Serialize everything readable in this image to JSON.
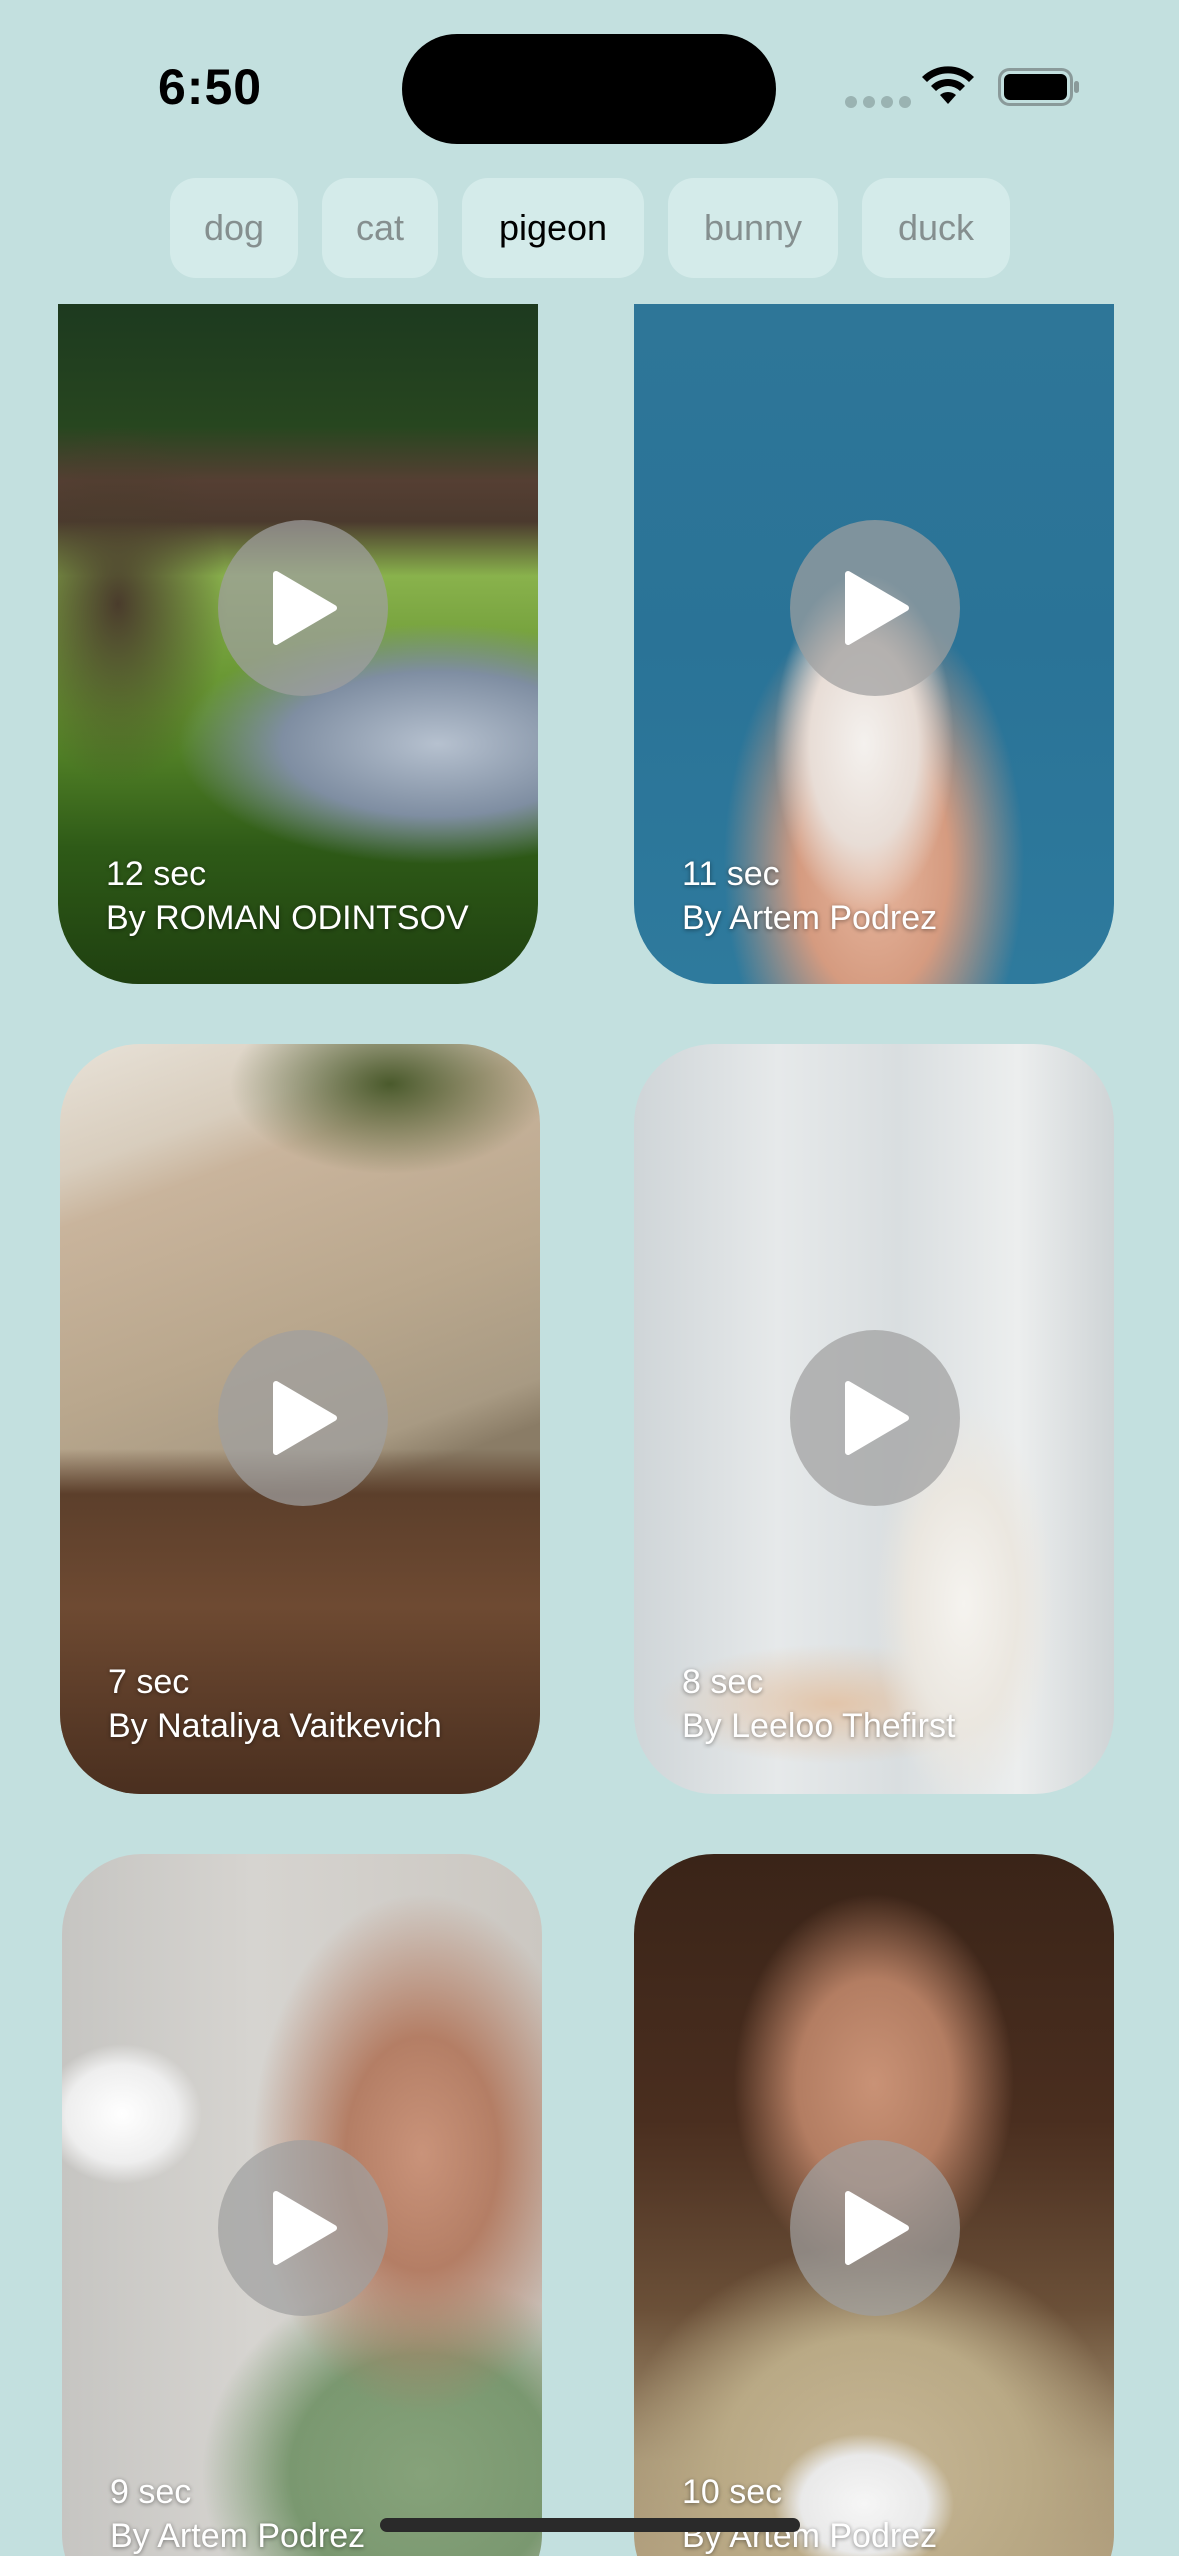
{
  "status": {
    "time": "6:50"
  },
  "chips": [
    "dog",
    "cat",
    "pigeon",
    "bunny",
    "duck"
  ],
  "active_chip": "pigeon",
  "videos": [
    {
      "duration": "12 sec",
      "author": "By ROMAN ODINTSOV"
    },
    {
      "duration": "11 sec",
      "author": "By Artem Podrez"
    },
    {
      "duration": "7 sec",
      "author": "By Nataliya Vaitkevich"
    },
    {
      "duration": "8 sec",
      "author": "By Leeloo Thefirst"
    },
    {
      "duration": "9 sec",
      "author": "By Artem Podrez"
    },
    {
      "duration": "10 sec",
      "author": "By Artem Podrez"
    }
  ],
  "icons": {
    "play": "play-icon",
    "wifi": "wifi-icon",
    "battery": "battery-icon",
    "signal": "cellular-signal-icon"
  }
}
